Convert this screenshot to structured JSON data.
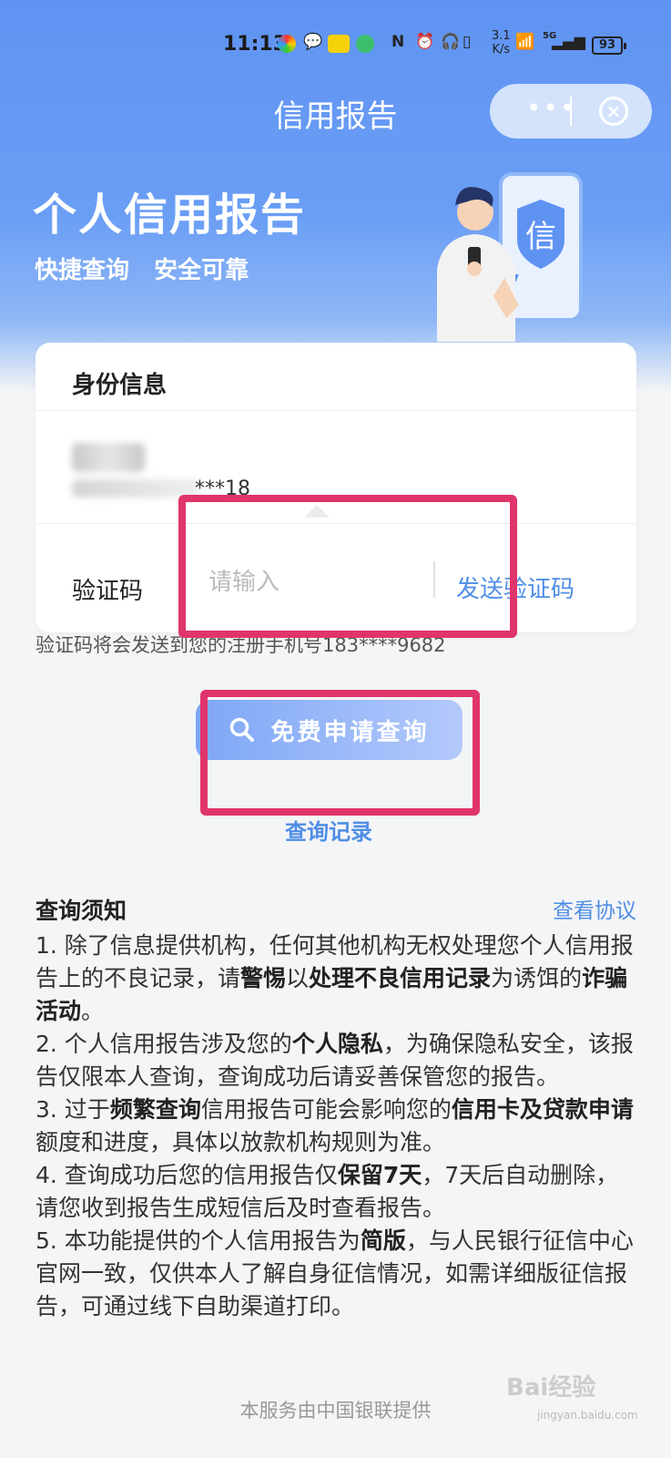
{
  "status_bar": {
    "time": "11:13",
    "net_speed_value": "3.1",
    "net_speed_unit": "K/s",
    "signal_label": "5G",
    "battery": "93"
  },
  "nav": {
    "title": "信用报告",
    "more": "•••",
    "close": "×"
  },
  "hero": {
    "title": "个人信用报告",
    "subtitle": "快捷查询   安全可靠",
    "badge_char": "信"
  },
  "identity": {
    "heading": "身份信息",
    "masked_number": "***18"
  },
  "verification": {
    "label": "验证码",
    "placeholder": "请输入",
    "send_label": "发送验证码",
    "hint": "验证码将会发送到您的注册手机号183****9682"
  },
  "actions": {
    "apply_label": "免费申请查询",
    "records_label": "查询记录"
  },
  "notice": {
    "heading": "查询须知",
    "agreement_link": "查看协议",
    "items": [
      {
        "parts": [
          "1. 除了信息提供机构，任何其他机构无权处理您个人信用报告上的不良记录，请",
          "警惕",
          "以",
          "处理不良信用记录",
          "为诱饵的",
          "诈骗活动",
          "。"
        ]
      },
      {
        "parts": [
          "2. 个人信用报告涉及您的",
          "个人隐私",
          "，为确保隐私安全，该报告仅限本人查询，查询成功后请妥善保管您的报告。"
        ]
      },
      {
        "parts": [
          "3. 过于",
          "频繁查询",
          "信用报告可能会影响您的",
          "信用卡及贷款申请",
          "额度和进度，具体以放款机构规则为准。"
        ]
      },
      {
        "parts": [
          "4. 查询成功后您的信用报告仅",
          "保留7天",
          "，7天后自动删除，请您收到报告生成短信后及时查看报告。"
        ]
      },
      {
        "parts": [
          "5. 本功能提供的个人信用报告为",
          "简版",
          "，与人民银行征信中心官网一致，仅供本人了解自身征信情况，如需详细版征信报告，可通过线下自助渠道打印。"
        ]
      }
    ]
  },
  "footer": "本服务由中国银联提供",
  "watermark": {
    "main": "Bai经验",
    "sub": "jingyan.baidu.com"
  },
  "colors": {
    "accent": "#4f8ee6",
    "highlight": "#e0356b",
    "hero_top": "#5f93f2"
  }
}
